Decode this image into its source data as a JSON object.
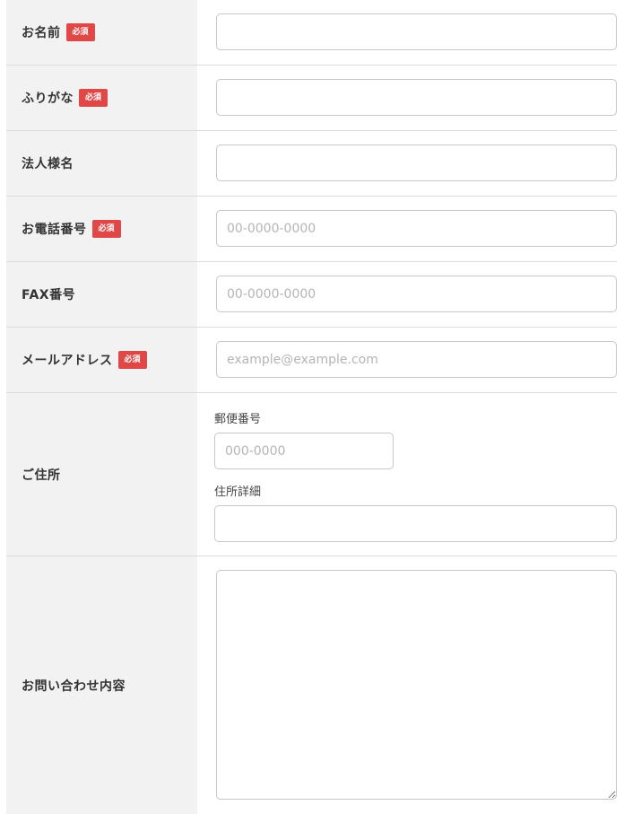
{
  "form": {
    "required_badge": "必須",
    "rows": {
      "name": {
        "label": "お名前",
        "required": true,
        "value": "",
        "placeholder": ""
      },
      "kana": {
        "label": "ふりがな",
        "required": true,
        "value": "",
        "placeholder": ""
      },
      "company": {
        "label": "法人様名",
        "required": false,
        "value": "",
        "placeholder": ""
      },
      "phone": {
        "label": "お電話番号",
        "required": true,
        "value": "",
        "placeholder": "00-0000-0000"
      },
      "fax": {
        "label": "FAX番号",
        "required": false,
        "value": "",
        "placeholder": "00-0000-0000"
      },
      "email": {
        "label": "メールアドレス",
        "required": true,
        "value": "",
        "placeholder": "example@example.com"
      },
      "address": {
        "label": "ご住所",
        "required": false,
        "postal_label": "郵便番号",
        "postal_placeholder": "000-0000",
        "detail_label": "住所詳細",
        "detail_placeholder": ""
      },
      "inquiry": {
        "label": "お問い合わせ内容",
        "required": false,
        "value": ""
      }
    }
  },
  "colors": {
    "label_bg": "#f2f2f2",
    "required_badge_bg": "#e04848",
    "input_border": "#c6c6c6",
    "row_divider": "#dcdcdc"
  }
}
